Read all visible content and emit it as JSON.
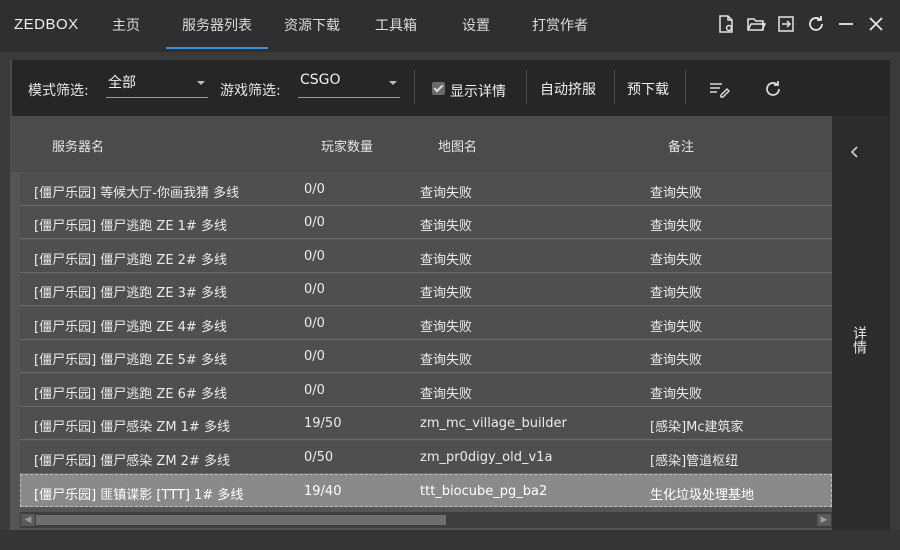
{
  "app": {
    "title": "ZEDBOX"
  },
  "nav": {
    "tabs": [
      {
        "label": "主页"
      },
      {
        "label": "服务器列表"
      },
      {
        "label": "资源下载"
      },
      {
        "label": "工具箱"
      },
      {
        "label": "设置"
      },
      {
        "label": "打赏作者"
      }
    ],
    "active_tab": "服务器列表"
  },
  "window_icons": [
    "file-settings-icon",
    "folder-open-icon",
    "login-icon",
    "refresh-icon",
    "minimize-icon",
    "close-icon"
  ],
  "toolbar": {
    "mode_filter_label": "模式筛选:",
    "mode_filter_value": "全部",
    "game_filter_label": "游戏筛选:",
    "game_filter_value": "CSGO",
    "show_details_label": "显示详情",
    "show_details_checked": true,
    "auto_join_label": "自动挤服",
    "pre_download_label": "预下载"
  },
  "table": {
    "headers": [
      "服务器名",
      "玩家数量",
      "地图名",
      "备注"
    ],
    "rows": [
      [
        "[僵尸乐园] 等候大厅-你画我猜 多线",
        "0/0",
        "查询失败",
        "查询失败"
      ],
      [
        "[僵尸乐园] 僵尸逃跑 ZE 1# 多线",
        "0/0",
        "查询失败",
        "查询失败"
      ],
      [
        "[僵尸乐园] 僵尸逃跑 ZE 2# 多线",
        "0/0",
        "查询失败",
        "查询失败"
      ],
      [
        "[僵尸乐园] 僵尸逃跑 ZE 3# 多线",
        "0/0",
        "查询失败",
        "查询失败"
      ],
      [
        "[僵尸乐园] 僵尸逃跑 ZE 4# 多线",
        "0/0",
        "查询失败",
        "查询失败"
      ],
      [
        "[僵尸乐园] 僵尸逃跑 ZE 5# 多线",
        "0/0",
        "查询失败",
        "查询失败"
      ],
      [
        "[僵尸乐园] 僵尸逃跑 ZE 6# 多线",
        "0/0",
        "查询失败",
        "查询失败"
      ],
      [
        "[僵尸乐园] 僵尸感染 ZM 1# 多线",
        "19/50",
        "zm_mc_village_builder",
        "[感染]Mc建筑家"
      ],
      [
        "[僵尸乐园] 僵尸感染 ZM 2# 多线",
        "0/50",
        "zm_pr0digy_old_v1a",
        "[感染]管道枢纽"
      ],
      [
        "[僵尸乐园] 匪镇谍影 [TTT] 1# 多线",
        "19/40",
        "ttt_biocube_pg_ba2",
        "生化垃圾处理基地"
      ]
    ],
    "selected_row": 9
  },
  "detail_panel": {
    "label": "详情"
  },
  "colors": {
    "accent": "#3d8fe0",
    "background": "#3a3a3a"
  }
}
